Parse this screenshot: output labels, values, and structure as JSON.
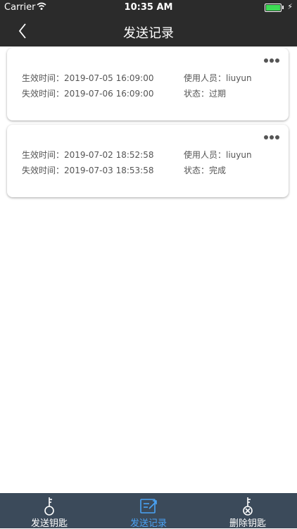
{
  "status": {
    "carrier": "Carrier",
    "time": "10:35 AM"
  },
  "nav": {
    "title": "发送记录"
  },
  "labels": {
    "start": "生效时间：",
    "end": "失效时间：",
    "user": "使用人员：",
    "state": "状态："
  },
  "records": [
    {
      "start": "2019-07-05 16:09:00",
      "end": "2019-07-06 16:09:00",
      "user": "liuyun",
      "state": "过期"
    },
    {
      "start": "2019-07-02 18:52:58",
      "end": "2019-07-03 18:53:58",
      "user": "liuyun",
      "state": "完成"
    }
  ],
  "tabs": [
    {
      "label": "发送钥匙",
      "icon": "key-icon"
    },
    {
      "label": "发送记录",
      "icon": "record-icon"
    },
    {
      "label": "删除钥匙",
      "icon": "delete-key-icon"
    }
  ],
  "colors": {
    "bar": "#2b2b2b",
    "tab_bar": "#3b4a5a",
    "active_tab": "#4aa3f5"
  }
}
